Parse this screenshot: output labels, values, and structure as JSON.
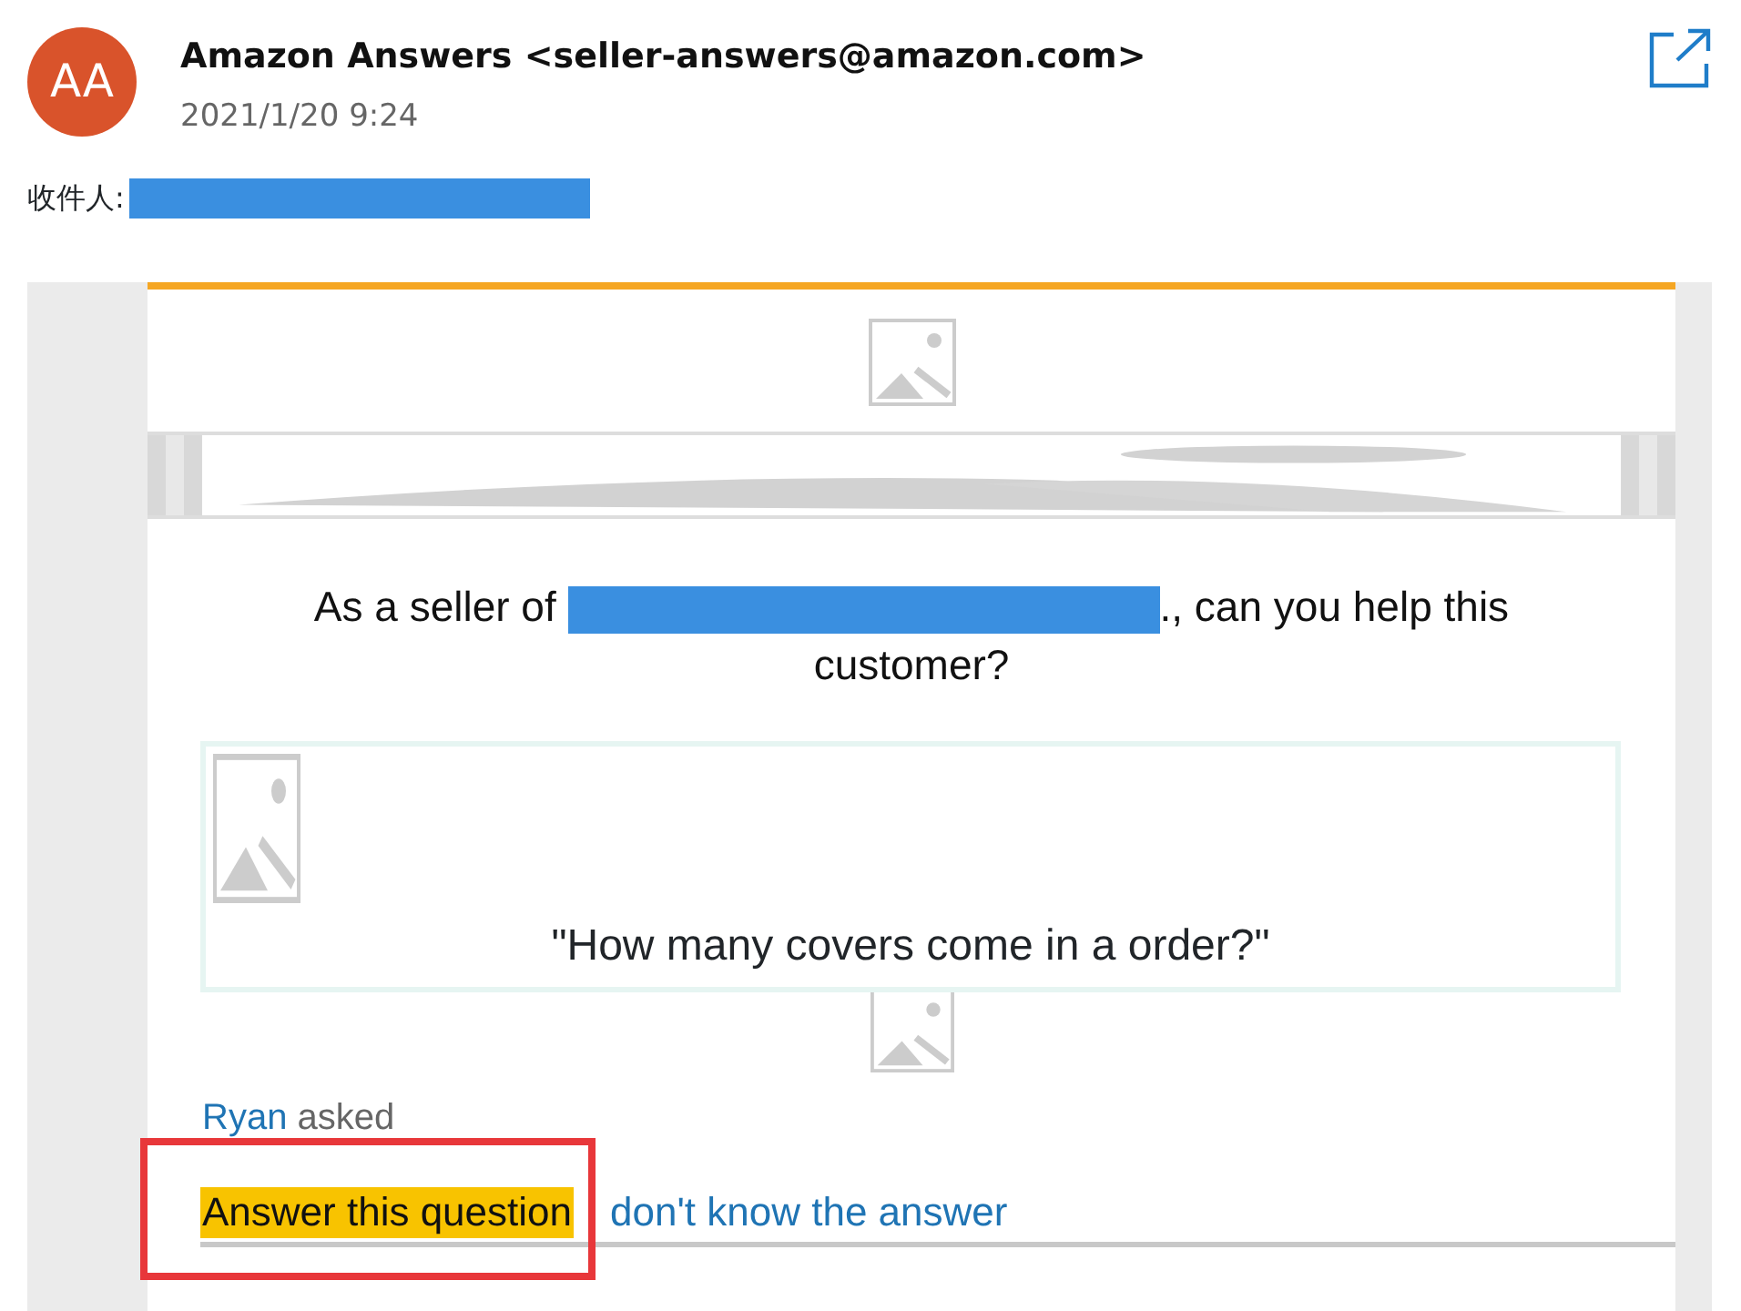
{
  "header": {
    "avatar_initials": "AA",
    "sender": "Amazon Answers <seller-answers@amazon.com>",
    "date": "2021/1/20 9:24",
    "to_label": "收件人:",
    "to_redacted": true
  },
  "email": {
    "question_prefix": "As a seller of",
    "question_redacted": true,
    "question_suffix": "., can you help this customer?",
    "quote": "\"How many covers come in a order?\"",
    "asker": "Ryan",
    "asked": "asked",
    "actions": [
      {
        "label": "Answer this question",
        "kind": "button",
        "highlighted": true
      },
      {
        "label": "don't know the answer",
        "kind": "link",
        "highlighted": false
      }
    ]
  }
}
